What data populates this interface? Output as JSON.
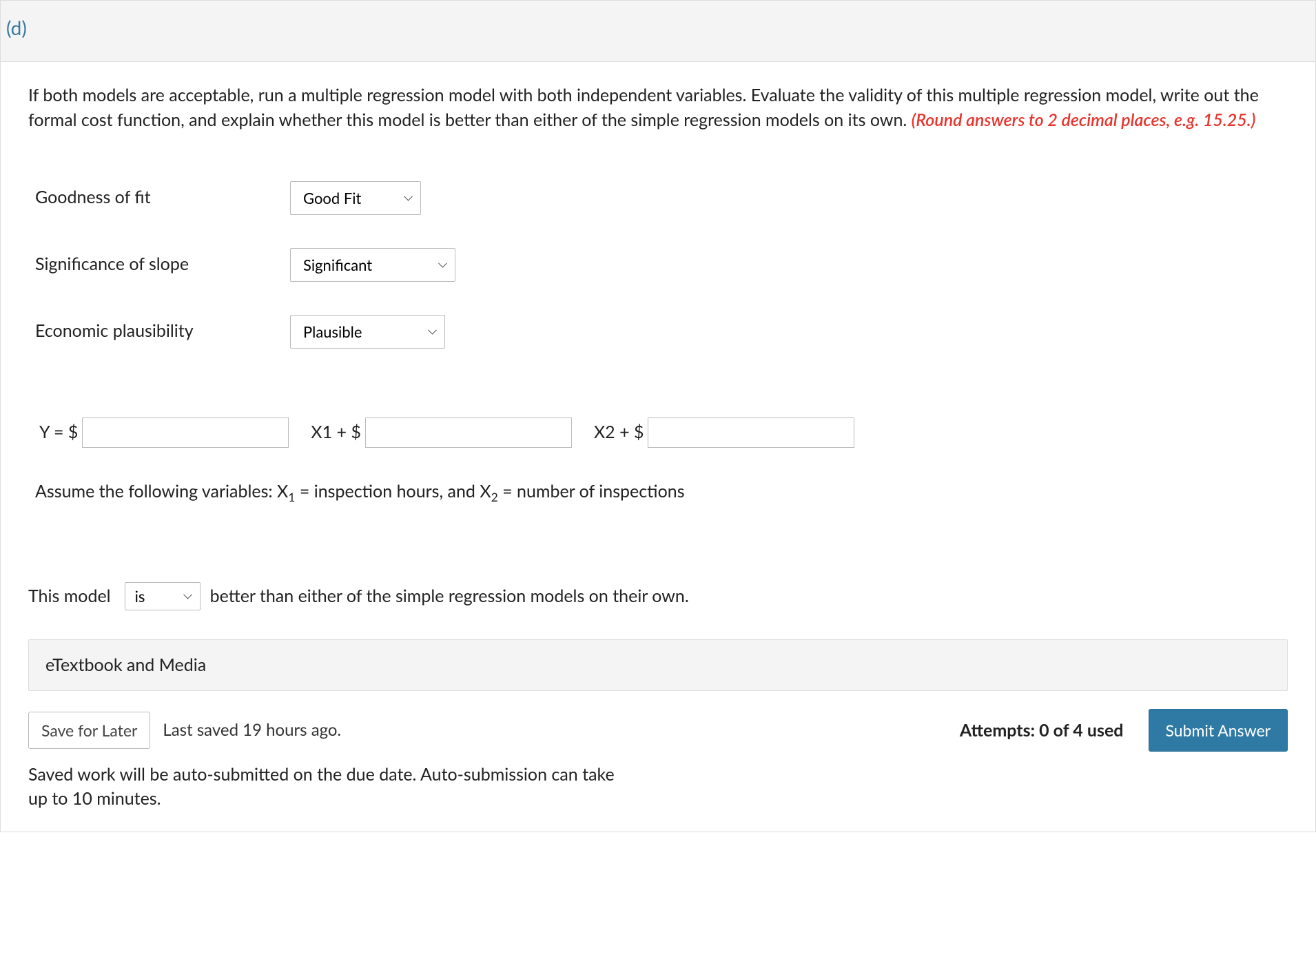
{
  "part": {
    "label": "(d)"
  },
  "question": {
    "body": "If both models are acceptable, run a multiple regression model with both independent variables. Evaluate the validity of this multiple regression model, write out the formal cost function, and explain whether this model is better than either of the simple regression models on its own. ",
    "round_hint": "(Round answers to 2 decimal places, e.g. 15.25.)"
  },
  "criteria": {
    "goodness": {
      "label": "Goodness of fit",
      "value": "Good Fit"
    },
    "significance": {
      "label": "Significance of slope",
      "value": "Significant"
    },
    "plausibility": {
      "label": "Economic plausibility",
      "value": "Plausible"
    }
  },
  "equation": {
    "y_prefix": "Y = $",
    "input1": "",
    "x1_text": "X1 + $",
    "input2": "",
    "x2_text": "X2 + $",
    "input3": ""
  },
  "assume": {
    "pre": "Assume the following variables: X",
    "sub1": "1",
    "mid": " = inspection hours, and X",
    "sub2": "2",
    "post": " = number of inspections"
  },
  "model_sentence": {
    "pre": "This model",
    "select_value": "is",
    "post": "better than either of the simple regression models on their own."
  },
  "etextbook": {
    "label": "eTextbook and Media"
  },
  "footer": {
    "save_label": "Save for Later",
    "last_saved": "Last saved 19 hours ago.",
    "attempts": "Attempts: 0 of 4 used",
    "submit_label": "Submit Answer",
    "auto_note": "Saved work will be auto-submitted on the due date. Auto-submission can take up to 10 minutes."
  }
}
